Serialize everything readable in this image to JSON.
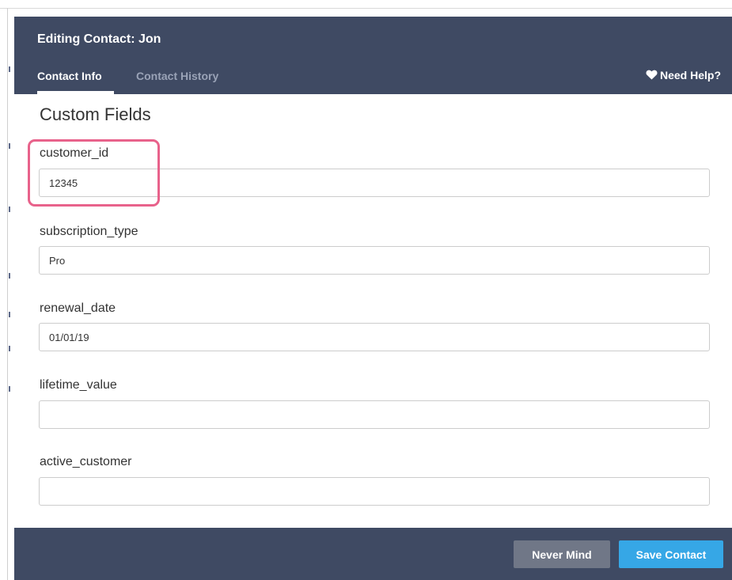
{
  "modal": {
    "title": "Editing Contact: Jon",
    "tabs": [
      {
        "label": "Contact Info",
        "active": true
      },
      {
        "label": "Contact History",
        "active": false
      }
    ],
    "help_label": "Need Help?",
    "help_icon": "heart-icon"
  },
  "section": {
    "title": "Custom Fields"
  },
  "fields": [
    {
      "label": "customer_id",
      "value": "12345",
      "highlighted": true
    },
    {
      "label": "subscription_type",
      "value": "Pro",
      "highlighted": false
    },
    {
      "label": "renewal_date",
      "value": "01/01/19",
      "highlighted": false
    },
    {
      "label": "lifetime_value",
      "value": "",
      "highlighted": false
    },
    {
      "label": "active_customer",
      "value": "",
      "highlighted": false
    }
  ],
  "footer": {
    "cancel_label": "Never Mind",
    "save_label": "Save Contact"
  },
  "colors": {
    "header_bg": "#3f4a63",
    "inactive_tab": "#9aa3b7",
    "highlight": "#e8628b",
    "cancel_button": "#707787",
    "save_button": "#36a7e6"
  }
}
